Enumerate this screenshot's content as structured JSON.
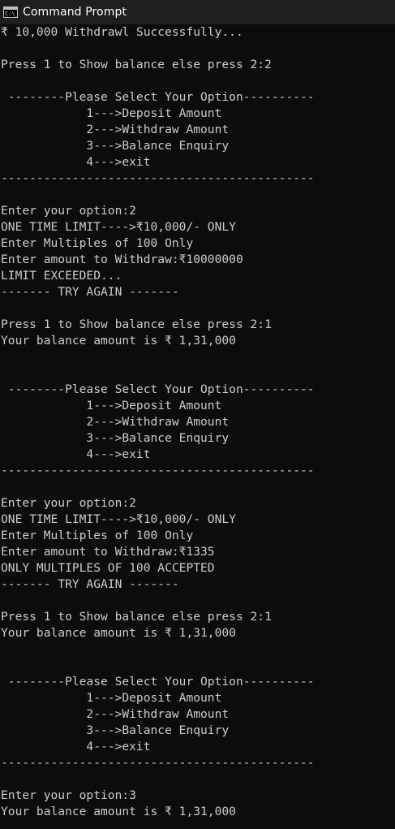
{
  "window": {
    "title": "Command Prompt",
    "icon": "cmd-icon",
    "icon_text": "C:\\_"
  },
  "console": {
    "lines": [
      "₹ 10,000 Withdrawl Successfully...",
      "",
      "Press 1 to Show balance else press 2:2",
      "",
      " --------Please Select Your Option----------",
      "            1--->Deposit Amount",
      "            2--->Withdraw Amount",
      "            3--->Balance Enquiry",
      "            4--->exit",
      "--------------------------------------------",
      "",
      "Enter your option:2",
      "ONE TIME LIMIT---->₹10,000/- ONLY",
      "Enter Multiples of 100 Only",
      "Enter amount to Withdraw:₹10000000",
      "LIMIT EXCEEDED...",
      "------- TRY AGAIN -------",
      "",
      "Press 1 to Show balance else press 2:1",
      "Your balance amount is ₹ 1,31,000",
      "",
      "",
      " --------Please Select Your Option----------",
      "            1--->Deposit Amount",
      "            2--->Withdraw Amount",
      "            3--->Balance Enquiry",
      "            4--->exit",
      "--------------------------------------------",
      "",
      "Enter your option:2",
      "ONE TIME LIMIT---->₹10,000/- ONLY",
      "Enter Multiples of 100 Only",
      "Enter amount to Withdraw:₹1335",
      "ONLY MULTIPLES OF 100 ACCEPTED",
      "------- TRY AGAIN -------",
      "",
      "Press 1 to Show balance else press 2:1",
      "Your balance amount is ₹ 1,31,000",
      "",
      "",
      " --------Please Select Your Option----------",
      "            1--->Deposit Amount",
      "            2--->Withdraw Amount",
      "            3--->Balance Enquiry",
      "            4--->exit",
      "--------------------------------------------",
      "",
      "Enter your option:3",
      "Your balance amount is ₹ 1,31,000"
    ]
  },
  "colors": {
    "background": "#0c0c0c",
    "titlebar": "#1e1e1e",
    "text": "#cccccc",
    "title_text": "#ffffff"
  }
}
